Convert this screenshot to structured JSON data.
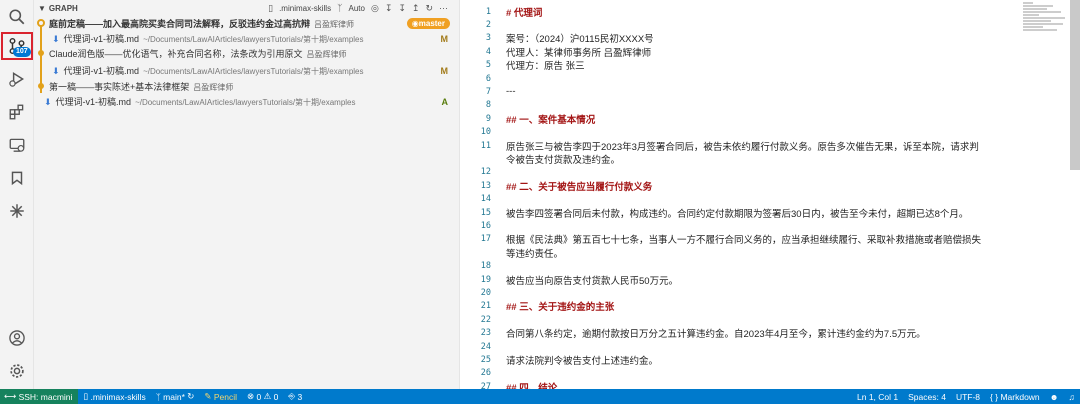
{
  "graph": {
    "header_title": "GRAPH",
    "repo_name": ".minimax-skills",
    "auto_label": "Auto",
    "branch_badge": "master",
    "commits": [
      {
        "message": "庭前定稿——加入最高院买卖合同司法解释，反驳违约金过高抗辩",
        "author": "吕盈辉律师",
        "file": {
          "name": "代理词-v1-初稿.md",
          "path": "~/Documents/LawAIArticles/lawyersTutorials/第十期/examples",
          "status": "M"
        }
      },
      {
        "message": "Claude润色版——优化语气，补充合同名称，法条改为引用原文",
        "author": "吕盈辉律师",
        "file": {
          "name": "代理词-v1-初稿.md",
          "path": "~/Documents/LawAIArticles/lawyersTutorials/第十期/examples",
          "status": "M"
        }
      },
      {
        "message": "第一稿——事实陈述+基本法律框架",
        "author": "吕盈辉律师",
        "file": {
          "name": "代理词-v1-初稿.md",
          "path": "~/Documents/LawAIArticles/lawyersTutorials/第十期/examples",
          "status": "A"
        }
      }
    ]
  },
  "editor": {
    "lines": [
      {
        "n": "1",
        "text": "# 代理词",
        "heading": true
      },
      {
        "n": "2",
        "text": "",
        "heading": false
      },
      {
        "n": "3",
        "text": "案号：（2024）沪0115民初XXXX号",
        "heading": false
      },
      {
        "n": "4",
        "text": "代理人：某律师事务所 吕盈辉律师",
        "heading": false
      },
      {
        "n": "5",
        "text": "代理方：原告 张三",
        "heading": false
      },
      {
        "n": "6",
        "text": "",
        "heading": false
      },
      {
        "n": "7",
        "text": "---",
        "heading": false
      },
      {
        "n": "8",
        "text": "",
        "heading": false
      },
      {
        "n": "9",
        "text": "## 一、案件基本情况",
        "heading": true
      },
      {
        "n": "10",
        "text": "",
        "heading": false
      },
      {
        "n": "11",
        "text": "原告张三与被告李四于2023年3月签署合同后，被告未依约履行付款义务。原告多次催告无果，诉至本院，请求判",
        "heading": false
      },
      {
        "n": "",
        "text": "令被告支付货款及违约金。",
        "heading": false
      },
      {
        "n": "12",
        "text": "",
        "heading": false
      },
      {
        "n": "13",
        "text": "## 二、关于被告应当履行付款义务",
        "heading": true
      },
      {
        "n": "14",
        "text": "",
        "heading": false
      },
      {
        "n": "15",
        "text": "被告李四签署合同后未付款，构成违约。合同约定付款期限为签署后30日内，被告至今未付，超期已达8个月。",
        "heading": false
      },
      {
        "n": "16",
        "text": "",
        "heading": false
      },
      {
        "n": "17",
        "text": "根据《民法典》第五百七十七条，当事人一方不履行合同义务的，应当承担继续履行、采取补救措施或者赔偿损失",
        "heading": false
      },
      {
        "n": "",
        "text": "等违约责任。",
        "heading": false
      },
      {
        "n": "18",
        "text": "",
        "heading": false
      },
      {
        "n": "19",
        "text": "被告应当向原告支付货款人民币50万元。",
        "heading": false
      },
      {
        "n": "20",
        "text": "",
        "heading": false
      },
      {
        "n": "21",
        "text": "## 三、关于违约金的主张",
        "heading": true
      },
      {
        "n": "22",
        "text": "",
        "heading": false
      },
      {
        "n": "23",
        "text": "合同第八条约定，逾期付款按日万分之五计算违约金。自2023年4月至今，累计违约金约为7.5万元。",
        "heading": false
      },
      {
        "n": "24",
        "text": "",
        "heading": false
      },
      {
        "n": "25",
        "text": "请求法院判令被告支付上述违约金。",
        "heading": false
      },
      {
        "n": "26",
        "text": "",
        "heading": false
      },
      {
        "n": "27",
        "text": "## 四、结论",
        "heading": true
      }
    ]
  },
  "activity": {
    "badge_count": "107"
  },
  "statusbar": {
    "remote": "SSH: macmini",
    "repo": ".minimax-skills",
    "branch": "main*",
    "pencil": "Pencil",
    "errors": "0",
    "warnings": "0",
    "ports": "3",
    "cursor": "Ln 1, Col 1",
    "spaces": "Spaces: 4",
    "encoding": "UTF-8",
    "language": "Markdown"
  },
  "colors": {
    "accent": "#007acc",
    "graph": "#e2a11a",
    "remote": "#16825d",
    "heading": "#a31515"
  }
}
